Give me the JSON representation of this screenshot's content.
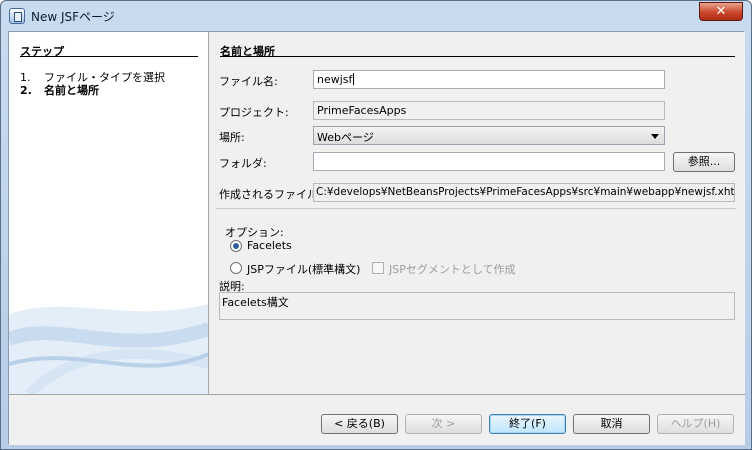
{
  "window": {
    "title": "New JSFページ",
    "close_label": "✕"
  },
  "steps": {
    "heading": "ステップ",
    "items": [
      {
        "num": "1.",
        "label": "ファイル・タイプを選択"
      },
      {
        "num": "2.",
        "label": "名前と場所"
      }
    ]
  },
  "form": {
    "heading": "名前と場所",
    "file_name_label": "ファイル名:",
    "file_name_value": "newjsf",
    "project_label": "プロジェクト:",
    "project_value": "PrimeFacesApps",
    "location_label": "場所:",
    "location_value": "Webページ",
    "folder_label": "フォルダ:",
    "folder_value": "",
    "browse_label": "参照...",
    "created_file_label": "作成されるファイル:",
    "created_file_value": "C:¥develops¥NetBeansProjects¥PrimeFacesApps¥src¥main¥webapp¥newjsf.xhtml"
  },
  "options": {
    "heading": "オプション:",
    "facelets_label": "Facelets",
    "jsp_file_label": "JSPファイル(標準構文)",
    "jsp_segment_label": "JSPセグメントとして作成",
    "description_label": "説明:",
    "description_value": "Facelets構文"
  },
  "footer": {
    "back_label": "< 戻る(B)",
    "next_label": "次 >",
    "finish_label": "終了(F)",
    "cancel_label": "取消",
    "help_label": "ヘルプ(H)"
  }
}
